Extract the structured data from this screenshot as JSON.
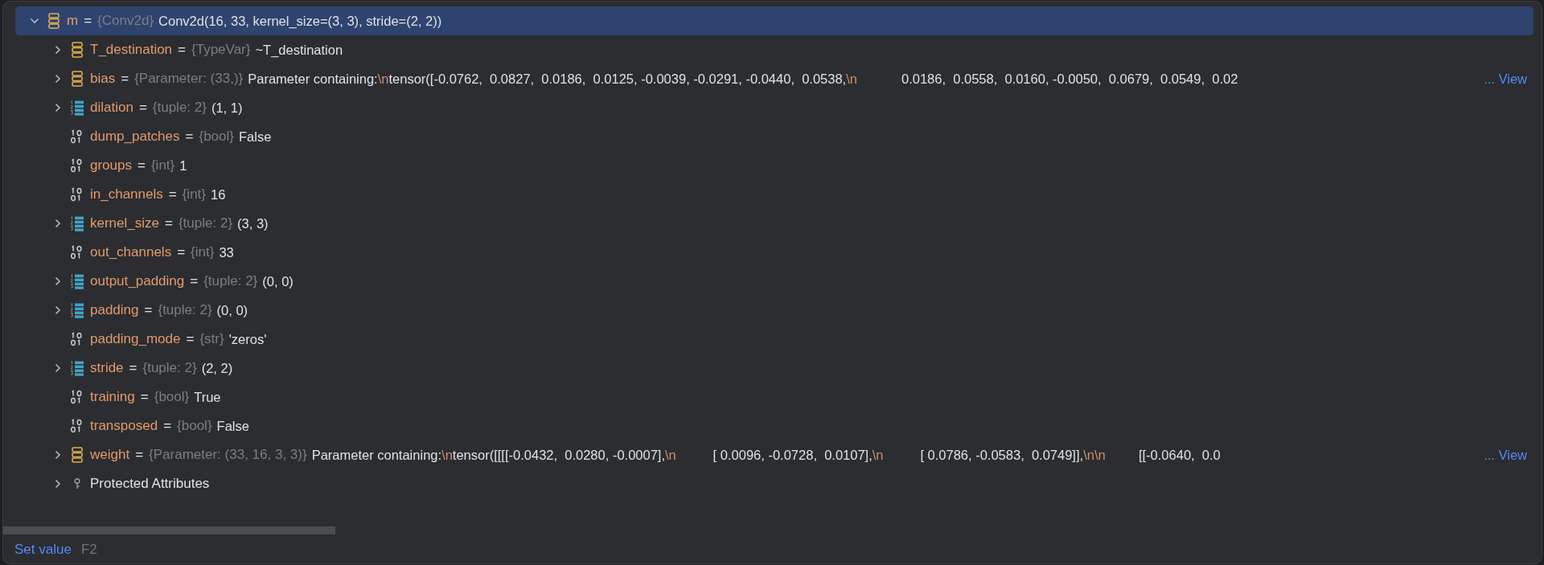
{
  "variables": [
    {
      "name": "m",
      "separator": "=",
      "type": "{Conv2d}",
      "kind": "object",
      "expanded": true,
      "selected": true,
      "value_parts": [
        {
          "kind": "text",
          "text": "Conv2d(16, 33, kernel_size=(3, 3), stride=(2, 2))"
        }
      ],
      "children": [
        {
          "name": "T_destination",
          "separator": "=",
          "type": "{TypeVar}",
          "kind": "object",
          "expanded": false,
          "selected": false,
          "value_parts": [
            {
              "kind": "text",
              "text": "~T_destination"
            }
          ]
        },
        {
          "name": "bias",
          "separator": "=",
          "type": "{Parameter: (33,)}",
          "kind": "object",
          "expanded": false,
          "selected": false,
          "value_parts": [
            {
              "kind": "text",
              "text": "Parameter containing:"
            },
            {
              "kind": "escape",
              "text": "\\n"
            },
            {
              "kind": "text",
              "text": "tensor([-0.0762,  0.0827,  0.0186,  0.0125, -0.0039, -0.0291, -0.0440,  0.0538,"
            },
            {
              "kind": "escape",
              "text": "\\n"
            },
            {
              "kind": "text",
              "text": "            0.0186,  0.0558,  0.0160, -0.0050,  0.0679,  0.0549,  0.02"
            }
          ],
          "link": "... View"
        },
        {
          "name": "dilation",
          "separator": "=",
          "type": "{tuple: 2}",
          "kind": "list",
          "expanded": false,
          "selected": false,
          "value_parts": [
            {
              "kind": "text",
              "text": "(1, 1)"
            }
          ]
        },
        {
          "name": "dump_patches",
          "separator": "=",
          "type": "{bool}",
          "kind": "binary",
          "selected": false,
          "value_parts": [
            {
              "kind": "text",
              "text": "False"
            }
          ]
        },
        {
          "name": "groups",
          "separator": "=",
          "type": "{int}",
          "kind": "binary",
          "selected": false,
          "value_parts": [
            {
              "kind": "text",
              "text": "1"
            }
          ]
        },
        {
          "name": "in_channels",
          "separator": "=",
          "type": "{int}",
          "kind": "binary",
          "selected": false,
          "value_parts": [
            {
              "kind": "text",
              "text": "16"
            }
          ]
        },
        {
          "name": "kernel_size",
          "separator": "=",
          "type": "{tuple: 2}",
          "kind": "list",
          "expanded": false,
          "selected": false,
          "value_parts": [
            {
              "kind": "text",
              "text": "(3, 3)"
            }
          ]
        },
        {
          "name": "out_channels",
          "separator": "=",
          "type": "{int}",
          "kind": "binary",
          "selected": false,
          "value_parts": [
            {
              "kind": "text",
              "text": "33"
            }
          ]
        },
        {
          "name": "output_padding",
          "separator": "=",
          "type": "{tuple: 2}",
          "kind": "list",
          "expanded": false,
          "selected": false,
          "value_parts": [
            {
              "kind": "text",
              "text": "(0, 0)"
            }
          ]
        },
        {
          "name": "padding",
          "separator": "=",
          "type": "{tuple: 2}",
          "kind": "list",
          "expanded": false,
          "selected": false,
          "value_parts": [
            {
              "kind": "text",
              "text": "(0, 0)"
            }
          ]
        },
        {
          "name": "padding_mode",
          "separator": "=",
          "type": "{str}",
          "kind": "binary",
          "selected": false,
          "value_parts": [
            {
              "kind": "text",
              "text": "'zeros'"
            }
          ]
        },
        {
          "name": "stride",
          "separator": "=",
          "type": "{tuple: 2}",
          "kind": "list",
          "expanded": false,
          "selected": false,
          "value_parts": [
            {
              "kind": "text",
              "text": "(2, 2)"
            }
          ]
        },
        {
          "name": "training",
          "separator": "=",
          "type": "{bool}",
          "kind": "binary",
          "selected": false,
          "value_parts": [
            {
              "kind": "text",
              "text": "True"
            }
          ]
        },
        {
          "name": "transposed",
          "separator": "=",
          "type": "{bool}",
          "kind": "binary",
          "selected": false,
          "value_parts": [
            {
              "kind": "text",
              "text": "False"
            }
          ]
        },
        {
          "name": "weight",
          "separator": "=",
          "type": "{Parameter: (33, 16, 3, 3)}",
          "kind": "object",
          "expanded": false,
          "selected": false,
          "value_parts": [
            {
              "kind": "text",
              "text": "Parameter containing:"
            },
            {
              "kind": "escape",
              "text": "\\n"
            },
            {
              "kind": "text",
              "text": "tensor([[[[-0.0432,  0.0280, -0.0007],"
            },
            {
              "kind": "escape",
              "text": "\\n"
            },
            {
              "kind": "text",
              "text": "          [ 0.0096, -0.0728,  0.0107],"
            },
            {
              "kind": "escape",
              "text": "\\n"
            },
            {
              "kind": "text",
              "text": "          [ 0.0786, -0.0583,  0.0749]],"
            },
            {
              "kind": "escape",
              "text": "\\n\\n"
            },
            {
              "kind": "text",
              "text": "         [[-0.0640,  0.0"
            }
          ],
          "link": "... View"
        },
        {
          "name": "Protected Attributes",
          "kind": "key",
          "expanded": false,
          "selected": false
        }
      ]
    }
  ],
  "footer": {
    "action": "Set value",
    "shortcut": "F2"
  }
}
